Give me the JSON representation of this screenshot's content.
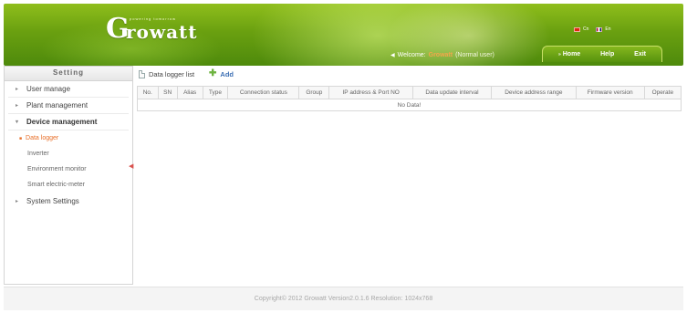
{
  "header": {
    "logo_letter": "G",
    "logo_rest": "rowatt",
    "logo_tagline": "powering tomorrow",
    "languages": [
      {
        "label": "Cn",
        "flag": "cn-flag-icon"
      },
      {
        "label": "En",
        "flag": "uk-flag-icon"
      }
    ],
    "welcome_label": "Welcome:",
    "username": "Growatt",
    "role": "(Normal user)",
    "nav": {
      "home": "Home",
      "help": "Help",
      "exit": "Exit"
    }
  },
  "sidebar": {
    "title": "Setting",
    "items": [
      {
        "label": "User manage"
      },
      {
        "label": "Plant management"
      },
      {
        "label": "Device management"
      },
      {
        "label": "System Settings"
      }
    ],
    "device_subitems": [
      {
        "label": "Data logger"
      },
      {
        "label": "Inverter"
      },
      {
        "label": "Environment monitor"
      },
      {
        "label": "Smart electric-meter"
      }
    ]
  },
  "main": {
    "list_title": "Data logger list",
    "add_label": "Add",
    "table": {
      "columns": [
        "No.",
        "SN",
        "Alias",
        "Type",
        "Connection status",
        "Group",
        "IP address & Port NO",
        "Data update interval",
        "Device address range",
        "Firmware version",
        "Operate"
      ],
      "empty_text": "No Data!"
    }
  },
  "footer": {
    "text": "Copyright©  2012  Growatt   Version2.0.1.6   Resolution: 1024x768"
  },
  "colors": {
    "header_green": "#6aa010",
    "accent_orange": "#e8702a",
    "add_blue": "#3c6fb4"
  }
}
